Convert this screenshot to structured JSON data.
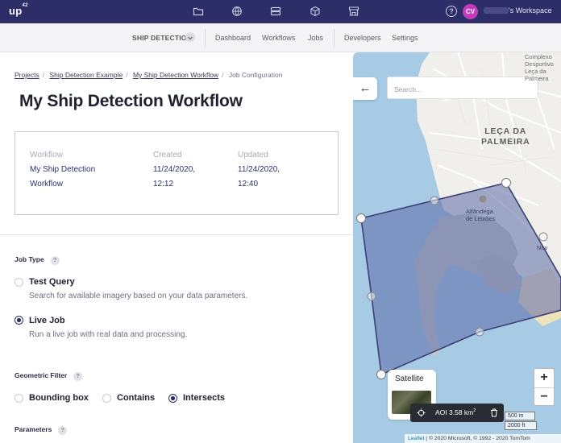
{
  "topbar": {
    "logo": "up",
    "logo_sup": "42",
    "nav_icons": [
      "folder-icon",
      "globe-icon",
      "storage-icon",
      "cube-icon",
      "store-icon"
    ],
    "help_icon": "?",
    "avatar_initials": "CV",
    "workspace_suffix": "'s Workspace",
    "colors": {
      "bar": "#2d2d67",
      "avatar": "#c53cbf"
    }
  },
  "subnav": {
    "project": "SHIP DETECTIO",
    "links": [
      "Dashboard",
      "Workflows",
      "Jobs",
      "Developers",
      "Settings"
    ]
  },
  "breadcrumb": {
    "items": [
      "Projects",
      "Ship Detection Example",
      "My Ship Detection Workflow"
    ],
    "current": "Job Configuration"
  },
  "page_title": "My Ship Detection Workflow",
  "info": {
    "workflow_label": "Workflow",
    "workflow_value": "My Ship Detection\nWorkflow",
    "created_label": "Created",
    "created_value": "11/24/2020,\n12:12",
    "updated_label": "Updated",
    "updated_value": "11/24/2020,\n12:40"
  },
  "job_type": {
    "label": "Job Type",
    "help": "?",
    "options": [
      {
        "title": "Test Query",
        "desc": "Search for available imagery based on your data parameters.",
        "selected": false
      },
      {
        "title": "Live Job",
        "desc": "Run a live job with real data and processing.",
        "selected": true
      }
    ]
  },
  "geometric_filter": {
    "label": "Geometric Filter",
    "help": "?",
    "options": [
      {
        "label": "Bounding box",
        "selected": false
      },
      {
        "label": "Contains",
        "selected": false
      },
      {
        "label": "Intersects",
        "selected": true
      }
    ]
  },
  "parameters": {
    "label": "Parameters",
    "help": "?"
  },
  "map": {
    "back_icon": "←",
    "search_placeholder": "Search...",
    "place_main": "LEÇA DA\nPALMEIRA",
    "place_top_right": "Complexo\nDesportivo\nLeça da\nPalmeira",
    "place_aduana": "Alfândega\nde Leixões",
    "place_nova": "Nov",
    "basemap_label": "Satellite",
    "aoi_label": "AOI 3.58 km",
    "aoi_unit_sup": "2",
    "zoom_in": "+",
    "zoom_out": "−",
    "scale_metric": "500 m",
    "scale_imperial": "2000 ft",
    "attribution_link": "Leaflet",
    "attribution_text": " | © 2020 Microsoft, © 1992 - 2020 TomTom",
    "colors": {
      "water": "#a7cbe5",
      "aoi_fill": "#5b6aa8",
      "aoi_stroke": "#3b3f74"
    }
  }
}
